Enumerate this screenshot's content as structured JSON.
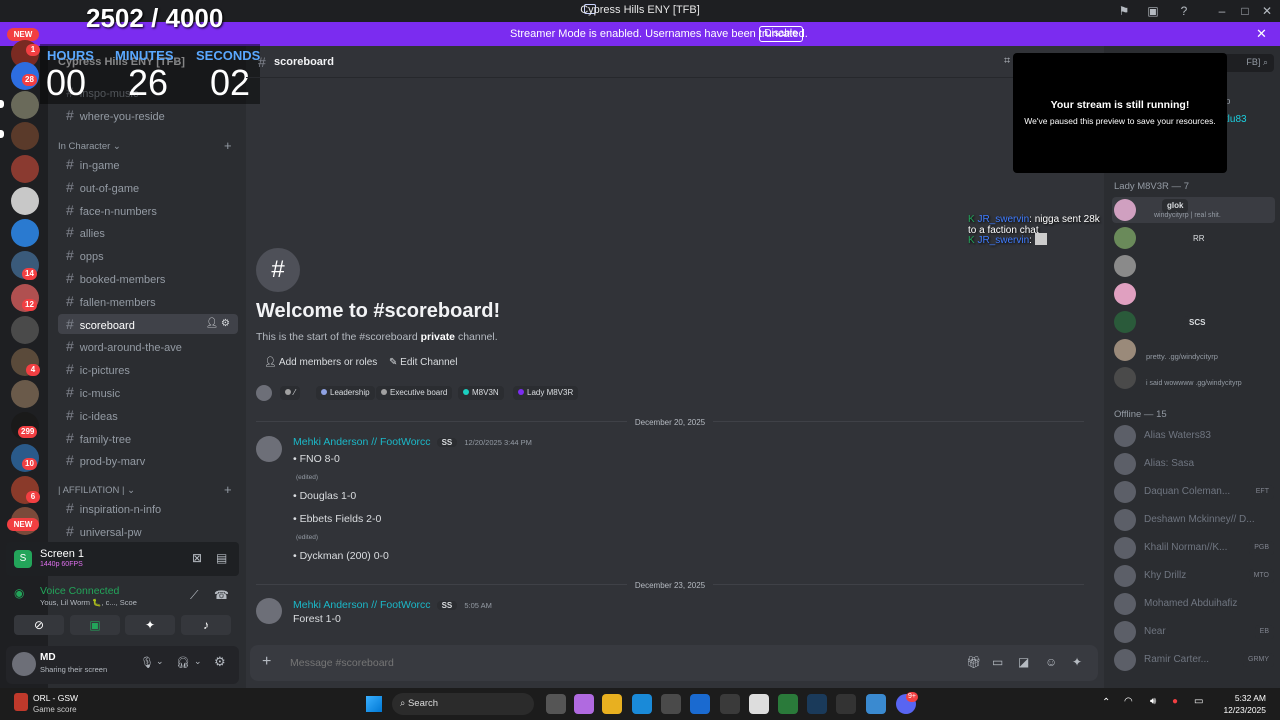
{
  "window": {
    "title": "Cypress Hills ENY [TFB]"
  },
  "banner": {
    "text": "Streamer Mode is enabled. Usernames have been truncated.",
    "button": "Disable"
  },
  "overlay_counter": "2502 / 4000",
  "timer": {
    "hours_label": "HOURS",
    "minutes_label": "MINUTES",
    "seconds_label": "SECONDS",
    "hours": "00",
    "minutes": "26",
    "seconds": "02"
  },
  "rail": {
    "new_top": "NEW",
    "new_bottom": "NEW",
    "badges": [
      "1",
      "28",
      "14",
      "12",
      "4",
      "299",
      "10",
      "6"
    ]
  },
  "sidebar": {
    "server_name": "Cypress Hills ENY [TFB]",
    "ch_cut": "inspo-music",
    "ch_reside": "where-you-reside",
    "cat_in_character": "In Character",
    "in_character": [
      "in-game",
      "out-of-game",
      "face-n-numbers",
      "allies",
      "opps",
      "booked-members",
      "fallen-members",
      "scoreboard",
      "word-around-the-ave",
      "ic-pictures",
      "ic-music",
      "ic-ideas",
      "family-tree",
      "prod-by-marv"
    ],
    "cat_affiliation": "| AFFILIATION |",
    "affiliation": [
      "inspiration-n-info",
      "universal-pw"
    ]
  },
  "stream": {
    "title": "Screen 1",
    "quality": "1440p 60FPS"
  },
  "voice": {
    "status": "Voice Connected",
    "members": "Yous, Lil Worm 🐛, c..., Scoe"
  },
  "user": {
    "name": "MD",
    "status": "Sharing their screen"
  },
  "channel_header": {
    "name": "scoreboard"
  },
  "welcome": {
    "title": "Welcome to #scoreboard!",
    "desc_prefix": "This is the start of the #scoreboard ",
    "desc_bold": "private",
    "desc_suffix": " channel.",
    "btn_add": "Add members or roles",
    "btn_edit": "Edit Channel",
    "roles": [
      "Leadership",
      "Executive board",
      "M8V3N",
      "Lady M8V3R"
    ],
    "role_colors": [
      "#8ea1e1",
      "#a0a0a0",
      "#1bd0c0",
      "#7b2cf0"
    ]
  },
  "messages": {
    "date1": "December 20, 2025",
    "m1_author": "Mehki Anderson // FootWorcc",
    "m1_tag": "SS",
    "m1_time": "12/20/2025 3:44 PM",
    "m1_lines": [
      "FNO 8-0",
      "Douglas 1-0",
      "Ebbets Fields 2-0",
      "Dyckman (200) 0-0"
    ],
    "edited": "(edited)",
    "date2": "December 23, 2025",
    "m2_author": "Mehki Anderson // FootWorcc",
    "m2_tag": "SS",
    "m2_time": "5:05 AM",
    "m2_text": "Forest 1-0"
  },
  "composer": {
    "placeholder": "Message #scoreboard"
  },
  "stream_overlay": {
    "title": "Your stream is still running!",
    "subtitle": "We've paused this preview to save your resources."
  },
  "float": {
    "user1": "JR_swervin",
    "msg1": "nigga sent 28k to a faction chat",
    "user2": "JR_swervin"
  },
  "memberlist": {
    "search_hint": "FB]",
    "top_frag_role": "rp",
    "top_frag_name": "Bklu83",
    "lady_header": "Lady M8V3R — 7",
    "lady_badge": "glok",
    "lady_status": "windycityrp | real shit.",
    "rr_tag": "RR",
    "scs_tag": "SCS",
    "status_pretty": "pretty. .gg/windycityrp",
    "status_wow": "i said wowwww .gg/windycityrp",
    "offline_header": "Offline — 15",
    "offline": [
      {
        "name": "Alias Waters83",
        "tag": ""
      },
      {
        "name": "Alias: Sasa",
        "tag": ""
      },
      {
        "name": "Daquan Coleman...",
        "tag": "EFT"
      },
      {
        "name": "Deshawn Mckinney// D...",
        "tag": ""
      },
      {
        "name": "Khalil Norman//K...",
        "tag": "PGB"
      },
      {
        "name": "Khy Drillz",
        "tag": "MTO"
      },
      {
        "name": "Mohamed Abduihafiz",
        "tag": ""
      },
      {
        "name": "Near",
        "tag": "EB"
      },
      {
        "name": "Ramir Carter...",
        "tag": "GRMY"
      }
    ]
  },
  "taskbar": {
    "widget_title": "ORL - GSW",
    "widget_sub": "Game score",
    "search": "Search",
    "time": "5:32 AM",
    "date": "12/23/2025",
    "discord_badge": "9+"
  }
}
